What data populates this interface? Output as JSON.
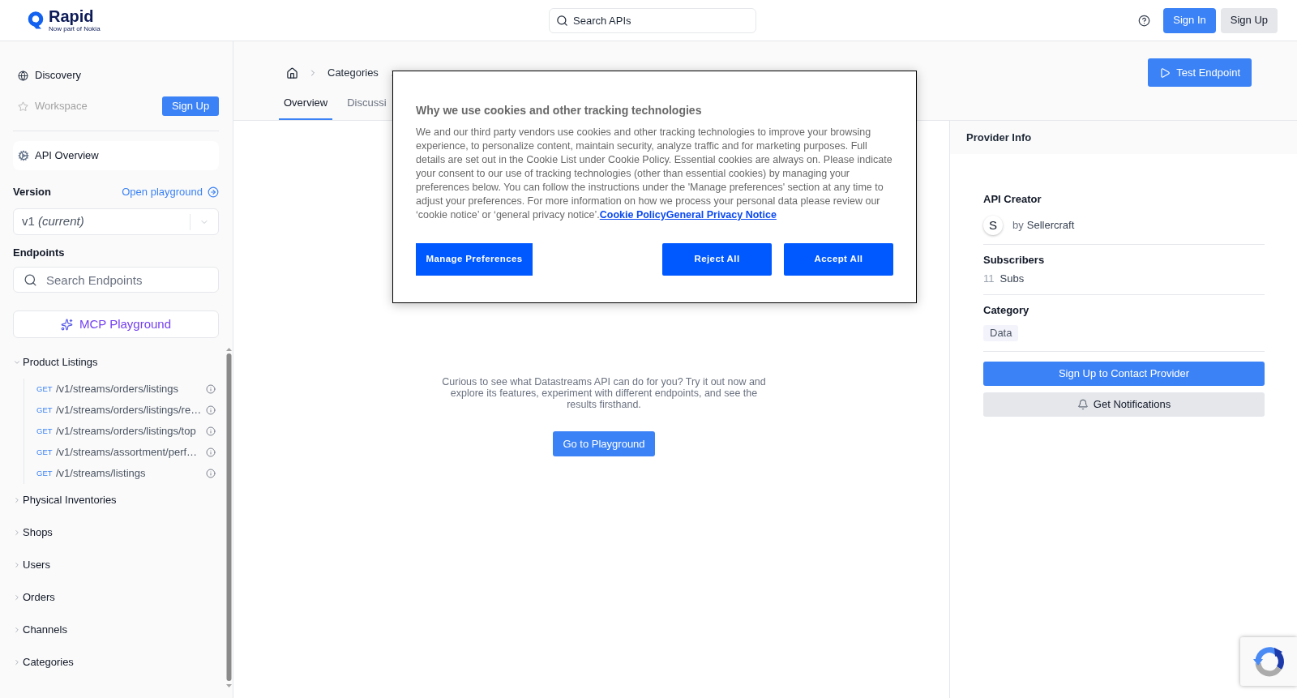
{
  "header": {
    "logo": {
      "wordmark": "Rapid",
      "tagline": "Now part of Nokia"
    },
    "search": {
      "placeholder": "Search APIs"
    },
    "buttons": [
      {
        "label": "Sign In",
        "kind": "primary"
      },
      {
        "label": "Sign Up",
        "kind": "secondary"
      }
    ]
  },
  "sidebar": {
    "nav": [
      {
        "label": "Discovery",
        "disabled": false
      },
      {
        "label": "Workspace",
        "disabled": true
      }
    ],
    "signup_button": "Sign Up",
    "api_overview": {
      "label": "API Overview",
      "selected": true
    },
    "version": {
      "label": "Version",
      "link": "Open playground",
      "value": "v1 *(current)*"
    },
    "endpoints": {
      "label": "Endpoints",
      "search_placeholder": "Search Endpoints"
    },
    "mcp_button": "MCP Playground",
    "groups": [
      {
        "label": "Product Listings",
        "expanded": true,
        "children": [
          {
            "method": "GET",
            "path": "/v1/streams/orders/listings"
          },
          {
            "method": "GET",
            "path": "/v1/streams/orders/listings/re…"
          },
          {
            "method": "GET",
            "path": "/v1/streams/orders/listings/top"
          },
          {
            "method": "GET",
            "path": "/v1/streams/assortment/perf…"
          },
          {
            "method": "GET",
            "path": "/v1/streams/listings"
          }
        ]
      },
      {
        "label": "Physical Inventories",
        "expanded": false
      },
      {
        "label": "Shops",
        "expanded": false
      },
      {
        "label": "Users",
        "expanded": false
      },
      {
        "label": "Orders",
        "expanded": false
      },
      {
        "label": "Channels",
        "expanded": false
      },
      {
        "label": "Categories",
        "expanded": false
      }
    ]
  },
  "main": {
    "breadcrumbs": [
      "Categories"
    ],
    "tabs": [
      {
        "label": "Overview",
        "selected": true
      },
      {
        "label": "Discussi",
        "selected": false
      }
    ],
    "action_button": "Test Endpoint",
    "overview": {
      "text": "Curious to see what Datastreams API can do for you? Try it out now and explore its features, experiment with different endpoints, and see the results firsthand.",
      "button": "Go to Playground"
    }
  },
  "provider_info": {
    "title": "Provider Info",
    "creator": {
      "label": "API Creator",
      "avatar": "S",
      "prefix": "by",
      "name": "Sellercraft"
    },
    "subscribers": {
      "label": "Subscribers",
      "count": "11",
      "unit": "Subs"
    },
    "category": {
      "label": "Category",
      "tag": "Data"
    },
    "buttons": [
      {
        "label": "Sign Up to Contact Provider",
        "kind": "primary"
      },
      {
        "label": "Get Notifications",
        "kind": "secondary"
      }
    ]
  },
  "cookie_dialog": {
    "title": "Why we use cookies and other tracking technologies",
    "body": "We and our third party vendors use cookies and other tracking technologies to improve your browsing experience, to personalize content, maintain security, analyze traffic and for marketing purposes. Full details are set out in the Cookie List under Cookie Policy. Essential cookies are always on. Please indicate your consent to our use of tracking technologies (other than essential cookies) by managing your preferences below. You can follow the instructions under the 'Manage preferences' section at any time to adjust your preferences. For more information on how we process your personal data please review our ‘cookie notice’ or ‘general privacy notice’.",
    "links": [
      "Cookie Policy",
      "General Privacy Notice"
    ],
    "buttons": [
      "Manage Preferences",
      "Reject All",
      "Accept All"
    ]
  }
}
